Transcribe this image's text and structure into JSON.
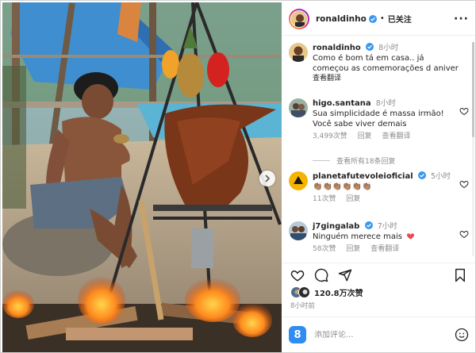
{
  "header": {
    "username": "ronaldinho",
    "separator": "•",
    "follow_label": "已关注",
    "more_label": "···"
  },
  "caption": {
    "username": "ronaldinho",
    "time": "8小时",
    "text_line1": "Como é bom tá em casa.. já",
    "text_line2": "começou as comemorações d aniver",
    "translate": "查看翻译"
  },
  "comments": [
    {
      "username": "higo.santana",
      "time": "8小时",
      "text_line1": "Sua simplicidade é massa irmão!",
      "text_line2": "Você sabe viver demais",
      "likes": "3,499次赞",
      "reply": "回复",
      "translate": "查看翻译"
    },
    {
      "username": "planetafutevoleioficial",
      "time": "5小时",
      "text_line1": "👏🏽👏🏽👏🏽👏🏽👏🏽👏🏽",
      "likes": "11次赞",
      "reply": "回复"
    },
    {
      "username": "j7gingalab",
      "time": "7小时",
      "text_line1": "Ninguém merece mais",
      "likes": "58次赞",
      "reply": "回复",
      "translate": "查看翻译"
    }
  ],
  "view_replies": "查看所有18条回复",
  "likes": {
    "count": "120.8万次赞"
  },
  "posted": "8小时前",
  "comment_box": {
    "placeholder": "添加评论...",
    "logo_letter": "8"
  },
  "icons": {
    "verified": "verified-badge-icon",
    "heart": "heart-icon",
    "comment": "comment-icon",
    "share": "share-icon",
    "bookmark": "bookmark-icon",
    "next": "chevron-right-icon",
    "emoji": "emoji-icon"
  },
  "colors": {
    "verified": "#3897f0",
    "accent_red": "#ed4956",
    "muted": "#8e8e8e"
  }
}
